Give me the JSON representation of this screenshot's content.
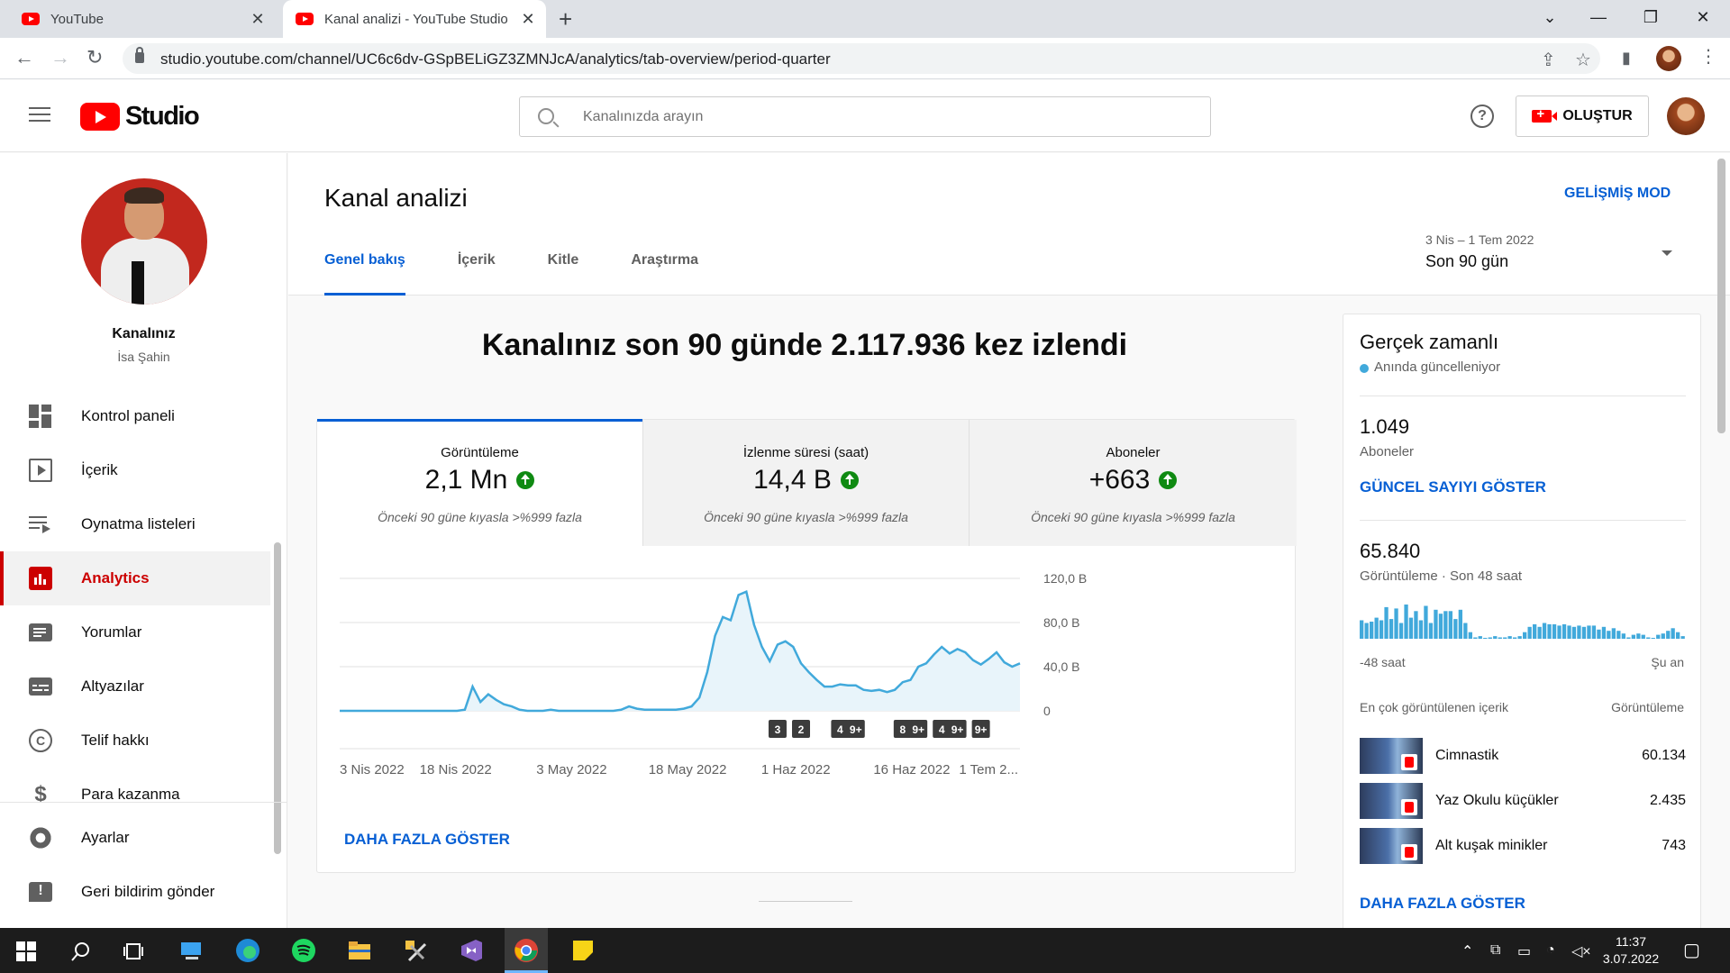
{
  "browser": {
    "tabs": [
      {
        "title": "YouTube",
        "active": false
      },
      {
        "title": "Kanal analizi - YouTube Studio",
        "active": true
      }
    ],
    "url": "studio.youtube.com/channel/UC6c6dv-GSpBELiGZ3ZMNJcA/analytics/tab-overview/period-quarter"
  },
  "header": {
    "logo_text": "Studio",
    "search_placeholder": "Kanalınızda arayın",
    "create_label": "OLUŞTUR"
  },
  "sidebar": {
    "channel_title": "Kanalınız",
    "channel_name": "İsa Şahin",
    "items": [
      {
        "label": "Kontrol paneli",
        "icon": "dashboard-icon"
      },
      {
        "label": "İçerik",
        "icon": "content-icon"
      },
      {
        "label": "Oynatma listeleri",
        "icon": "playlists-icon"
      },
      {
        "label": "Analytics",
        "icon": "analytics-icon",
        "active": true
      },
      {
        "label": "Yorumlar",
        "icon": "comments-icon"
      },
      {
        "label": "Altyazılar",
        "icon": "subtitles-icon"
      },
      {
        "label": "Telif hakkı",
        "icon": "copyright-icon"
      },
      {
        "label": "Para kazanma",
        "icon": "monetization-icon"
      }
    ],
    "bottom_items": [
      {
        "label": "Ayarlar",
        "icon": "settings-icon"
      },
      {
        "label": "Geri bildirim gönder",
        "icon": "feedback-icon"
      }
    ]
  },
  "page": {
    "title": "Kanal analizi",
    "advanced_mode": "GELİŞMİŞ MOD",
    "tabs": [
      "Genel bakış",
      "İçerik",
      "Kitle",
      "Araştırma"
    ],
    "active_tab": 0,
    "period_range": "3 Nis – 1 Tem 2022",
    "period_label": "Son 90 gün",
    "headline": "Kanalınız son 90 günde 2.117.936 kez izlendi",
    "show_more": "DAHA FAZLA GÖSTER"
  },
  "metrics": [
    {
      "label": "Görüntüleme",
      "value": "2,1 Mn",
      "comparison": "Önceki 90 güne kıyasla >%999 fazla",
      "active": true
    },
    {
      "label": "İzlenme süresi (saat)",
      "value": "14,4 B",
      "comparison": "Önceki 90 güne kıyasla >%999 fazla",
      "active": false
    },
    {
      "label": "Aboneler",
      "value": "+663",
      "comparison": "Önceki 90 güne kıyasla >%999 fazla",
      "active": false
    }
  ],
  "chart_data": {
    "type": "area",
    "series": [
      {
        "values": [
          0,
          0,
          0,
          0,
          0,
          0,
          0,
          0,
          0,
          0,
          0,
          0,
          0,
          0,
          0,
          0,
          1,
          22,
          8,
          15,
          10,
          6,
          4,
          1,
          0,
          0,
          0,
          1,
          0,
          0,
          0,
          0,
          0,
          0,
          0,
          0,
          1,
          4,
          2,
          1,
          1,
          1,
          1,
          1,
          2,
          4,
          12,
          35,
          68,
          85,
          82,
          105,
          108,
          78,
          58,
          45,
          60,
          63,
          58,
          43,
          35,
          28,
          22,
          22,
          24,
          23,
          23,
          19,
          18,
          19,
          17,
          19,
          26,
          28,
          40,
          43,
          51,
          58,
          52,
          56,
          53,
          46,
          42,
          47,
          53,
          44,
          40,
          43
        ]
      }
    ],
    "x_tick_labels": [
      "3 Nis 2022",
      "18 Nis 2022",
      "3 May 2022",
      "18 May 2022",
      "1 Haz 2022",
      "16 Haz 2022",
      "1 Tem 2..."
    ],
    "y_tick_labels": [
      "0",
      "40,0 B",
      "80,0 B",
      "120,0 B"
    ],
    "y_ticks": [
      0,
      40,
      80,
      120
    ],
    "ylim": [
      0,
      120
    ],
    "upload_markers": [
      "3",
      "2",
      "4",
      "9+",
      "8",
      "9+",
      "4",
      "9+",
      "9+"
    ],
    "grid": true,
    "color": "#41a9db"
  },
  "realtime": {
    "title": "Gerçek zamanlı",
    "live_label": "Anında güncelleniyor",
    "subscribers_value": "1.049",
    "subscribers_label": "Aboneler",
    "show_count": "GÜNCEL SAYIYI GÖSTER",
    "views_value": "65.840",
    "views_label": "Görüntüleme · Son 48 saat",
    "hourly_views": [
      14,
      12,
      13,
      16,
      14,
      24,
      15,
      23,
      12,
      26,
      16,
      21,
      14,
      25,
      12,
      22,
      19,
      21,
      21,
      15,
      22,
      12,
      5,
      1,
      2,
      0,
      1,
      2,
      1,
      1,
      2,
      1,
      2,
      5,
      9,
      11,
      9,
      12,
      11,
      11,
      10,
      11,
      10,
      9,
      10,
      9,
      10,
      10,
      7,
      9,
      6,
      8,
      6,
      4,
      1,
      3,
      4,
      3,
      1,
      0,
      3,
      4,
      6,
      8,
      5,
      2
    ],
    "axis_start": "-48 saat",
    "axis_end": "Şu an",
    "top_content_header": "En çok görüntülenen içerik",
    "top_content_views_header": "Görüntüleme",
    "top_content": [
      {
        "title": "Cimnastik",
        "views": "60.134"
      },
      {
        "title": "Yaz Okulu küçükler",
        "views": "2.435"
      },
      {
        "title": "Alt kuşak minikler",
        "views": "743"
      }
    ],
    "show_more": "DAHA FAZLA GÖSTER"
  },
  "taskbar": {
    "time": "11:37",
    "date": "3.07.2022"
  }
}
